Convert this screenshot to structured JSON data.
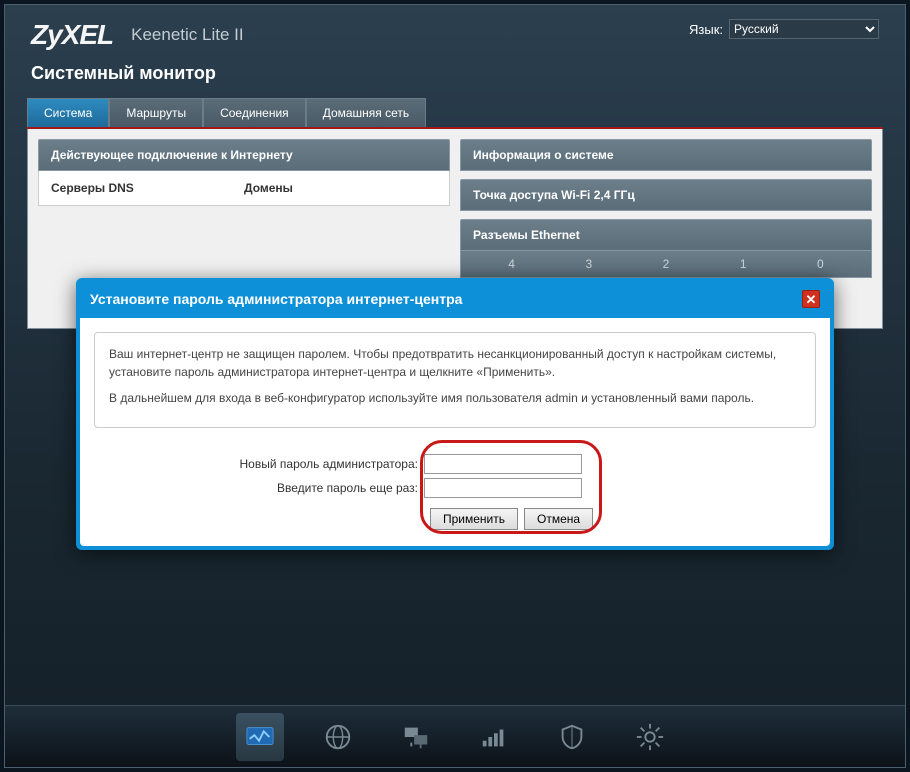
{
  "header": {
    "logo": "ZyXEL",
    "model": "Keenetic Lite II",
    "lang_label": "Язык:",
    "lang_value": "Русский"
  },
  "page_title": "Системный монитор",
  "tabs": [
    {
      "label": "Система",
      "active": true
    },
    {
      "label": "Маршруты",
      "active": false
    },
    {
      "label": "Соединения",
      "active": false
    },
    {
      "label": "Домашняя сеть",
      "active": false
    }
  ],
  "left_panels": [
    {
      "header": "Действующее подключение к Интернету",
      "cols": [
        "Серверы DNS",
        "Домены"
      ]
    }
  ],
  "right_panels": [
    {
      "header": "Информация о системе"
    },
    {
      "header": "Точка доступа Wi-Fi 2,4 ГГц"
    },
    {
      "header": "Разъемы Ethernet",
      "ports": [
        "4",
        "3",
        "2",
        "1",
        "0"
      ]
    }
  ],
  "bottom_icons": [
    "status-icon",
    "internet-icon",
    "network-icon",
    "wifi-icon",
    "security-icon",
    "settings-icon"
  ],
  "modal": {
    "title": "Установите пароль администратора интернет-центра",
    "msg1": "Ваш интернет-центр не защищен паролем. Чтобы предотвратить несанкционированный доступ к настройкам системы, установите пароль администратора интернет-центра и щелкните «Применить».",
    "msg2": "В дальнейшем для входа в веб-конфигуратор используйте имя пользователя admin и установленный вами пароль.",
    "label_new": "Новый пароль администратора:",
    "label_rep": "Введите пароль еще раз:",
    "btn_apply": "Применить",
    "btn_cancel": "Отмена"
  }
}
